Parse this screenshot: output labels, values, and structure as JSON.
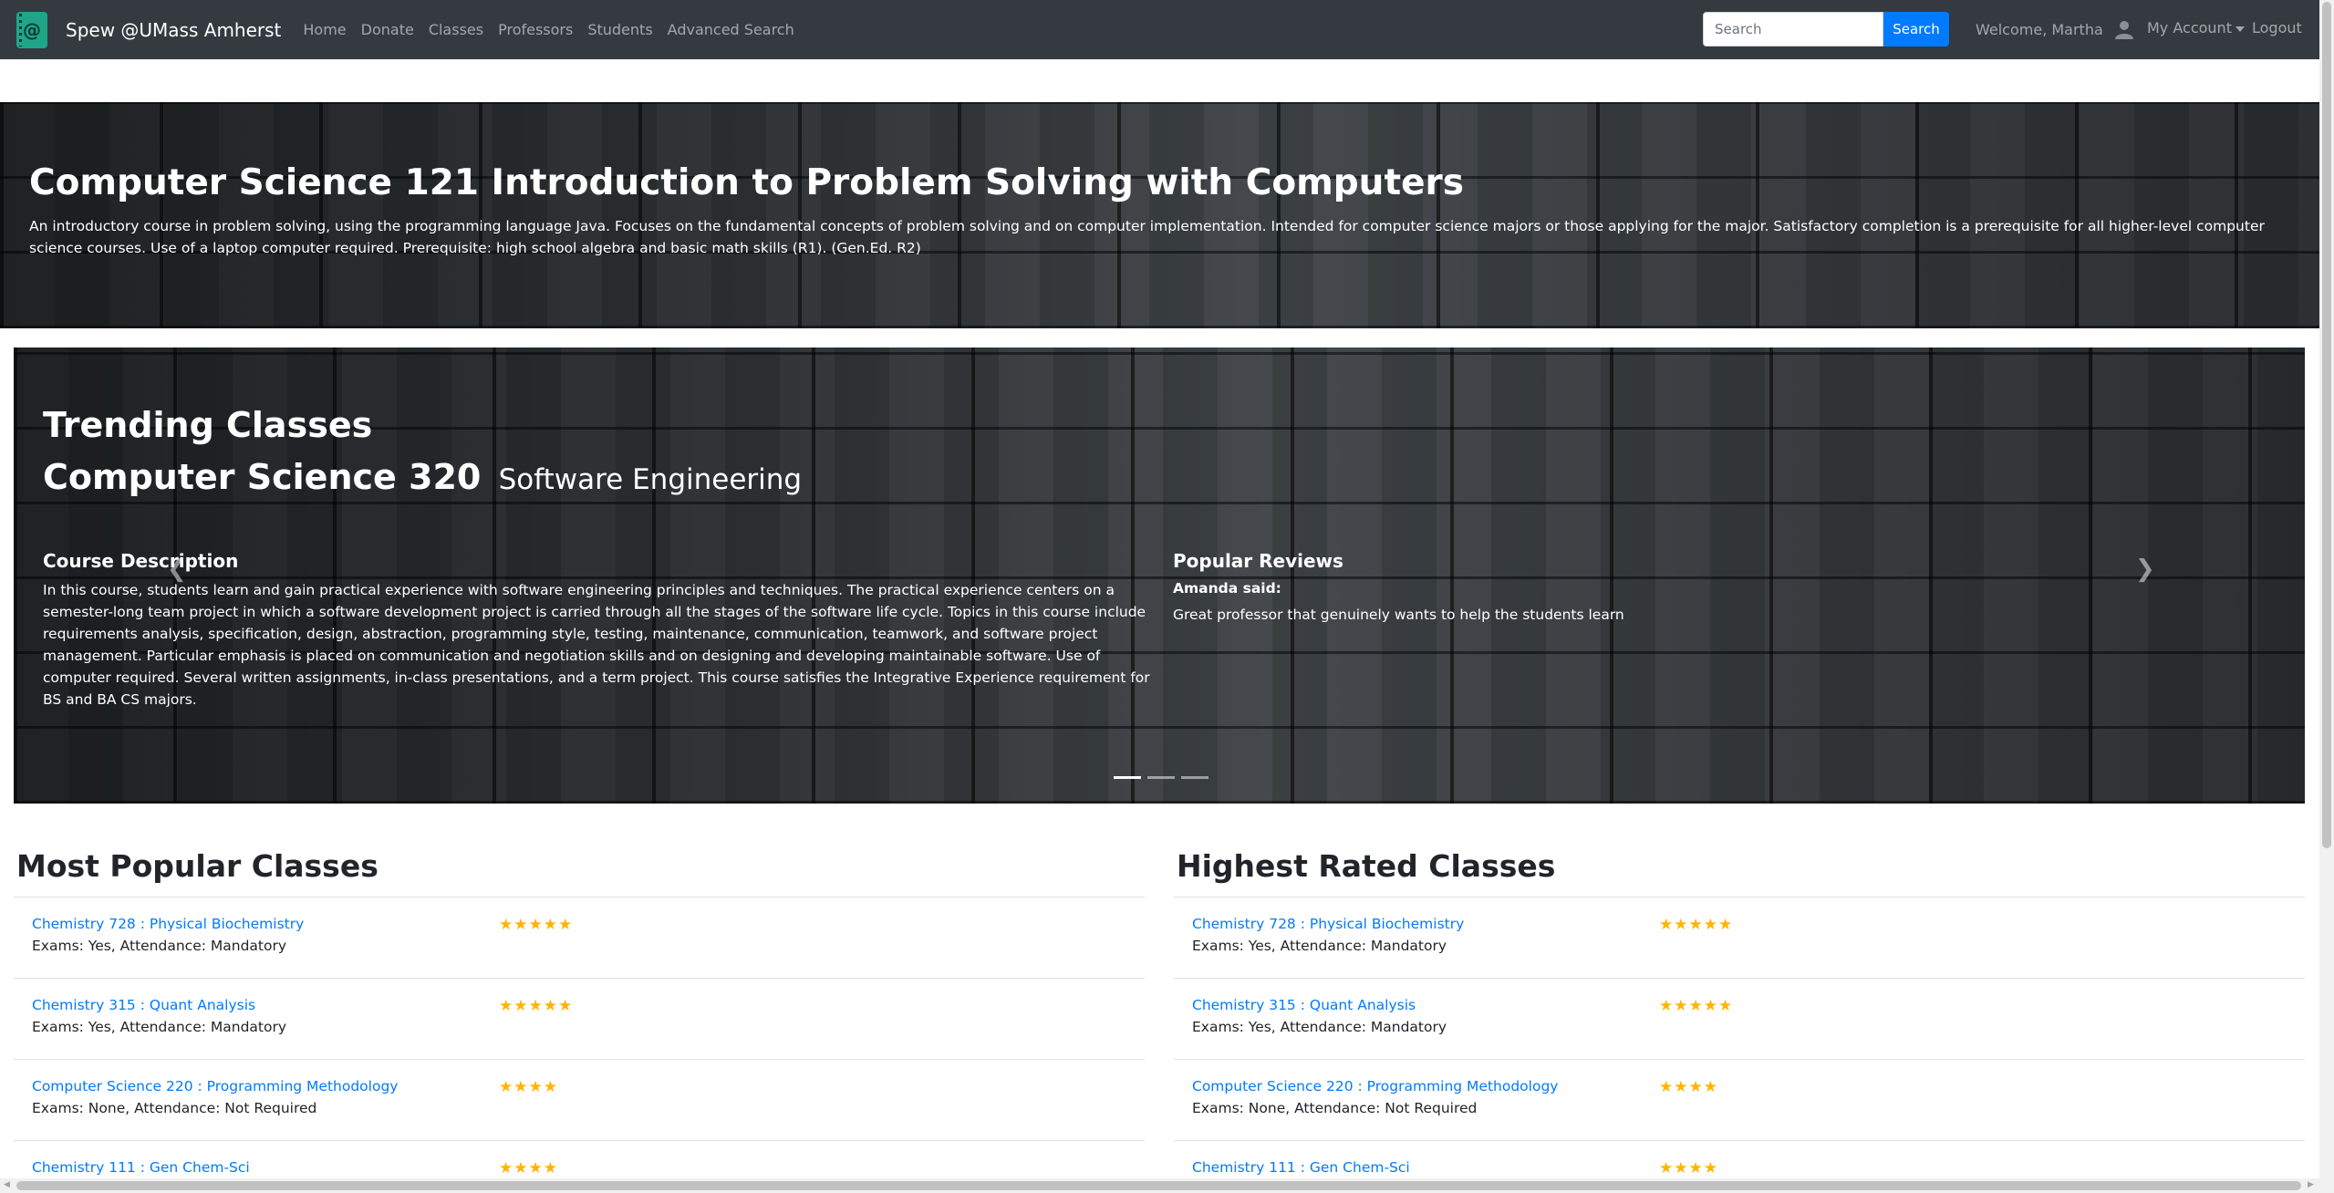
{
  "navbar": {
    "brand": "Spew @UMass Amherst",
    "links": [
      "Home",
      "Donate",
      "Classes",
      "Professors",
      "Students",
      "Advanced Search"
    ],
    "search_placeholder": "Search",
    "search_button": "Search",
    "welcome": "Welcome, Martha",
    "account": "My Account",
    "logout": "Logout"
  },
  "jumbotron": {
    "title": "Computer Science 121 Introduction to Problem Solving with Computers",
    "description": "An introductory course in problem solving, using the programming language Java. Focuses on the fundamental concepts of problem solving and on computer implementation. Intended for computer science majors or those applying for the major. Satisfactory completion is a prerequisite for all higher-level computer science courses. Use of a laptop computer required. Prerequisite: high school algebra and basic math skills (R1). (Gen.Ed. R2)"
  },
  "carousel": {
    "heading": "Trending Classes",
    "course_code": "Computer Science 320",
    "course_name": "Software Engineering",
    "description_heading": "Course Description",
    "description": "In this course, students learn and gain practical experience with software engineering principles and techniques. The practical experience centers on a semester-long team project in which a software development project is carried through all the stages of the software life cycle. Topics in this course include requirements analysis, specification, design, abstraction, programming style, testing, maintenance, communication, teamwork, and software project management. Particular emphasis is placed on communication and negotiation skills and on designing and developing maintainable software. Use of computer required. Several written assignments, in-class presentations, and a term project. This course satisfies the Integrative Experience requirement for BS and BA CS majors.",
    "reviews_heading": "Popular Reviews",
    "review_author": "Amanda said:",
    "review_text": "Great professor that genuinely wants to help the students learn",
    "active_slide": 1,
    "slide_count": 3
  },
  "most_popular": {
    "title": "Most Popular Classes",
    "items": [
      {
        "name": "Chemistry 728 : Physical Biochemistry",
        "meta": "Exams: Yes, Attendance: Mandatory",
        "stars": 5
      },
      {
        "name": "Chemistry 315 : Quant Analysis",
        "meta": "Exams: Yes, Attendance: Mandatory",
        "stars": 5
      },
      {
        "name": "Computer Science 220 : Programming Methodology",
        "meta": "Exams: None, Attendance: Not Required",
        "stars": 4
      },
      {
        "name": "Chemistry 111 : Gen Chem-Sci",
        "meta": "",
        "stars": 4
      }
    ]
  },
  "highest_rated": {
    "title": "Highest Rated Classes",
    "items": [
      {
        "name": "Chemistry 728 : Physical Biochemistry",
        "meta": "Exams: Yes, Attendance: Mandatory",
        "stars": 5
      },
      {
        "name": "Chemistry 315 : Quant Analysis",
        "meta": "Exams: Yes, Attendance: Mandatory",
        "stars": 5
      },
      {
        "name": "Computer Science 220 : Programming Methodology",
        "meta": "Exams: None, Attendance: Not Required",
        "stars": 4
      },
      {
        "name": "Chemistry 111 : Gen Chem-Sci",
        "meta": "",
        "stars": 4
      }
    ]
  },
  "colors": {
    "navbar_bg": "#343a40",
    "primary": "#007bff",
    "star": "#ffb400",
    "logo": "#1fa58a"
  }
}
